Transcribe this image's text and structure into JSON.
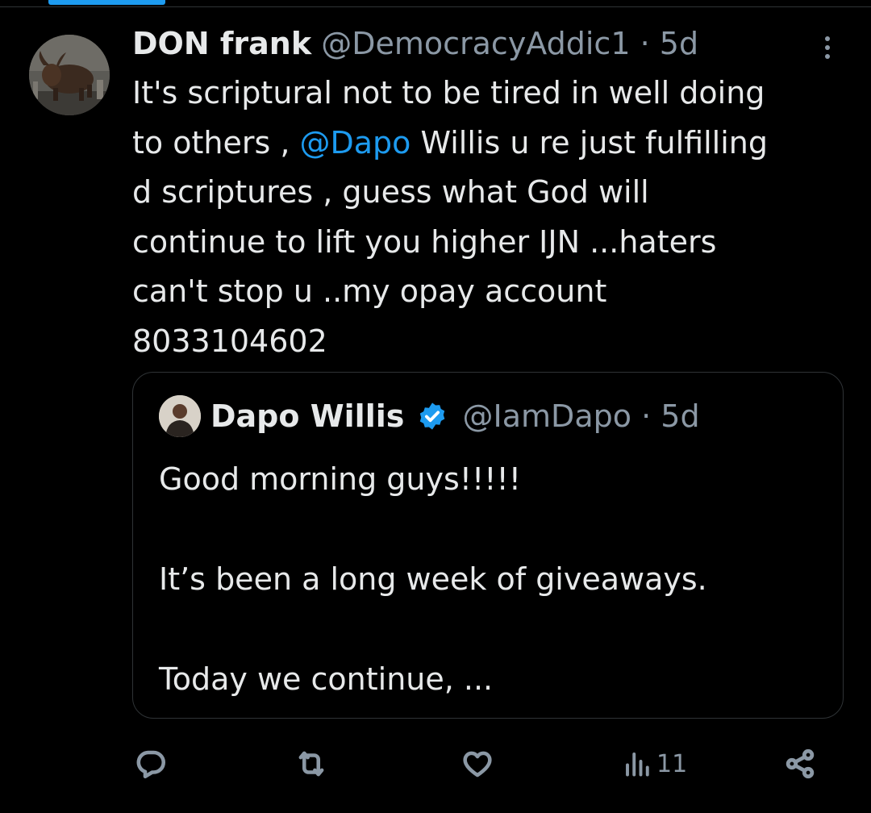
{
  "tweet": {
    "display_name": "DON frank",
    "handle": "@DemocracyAddic1",
    "separator": "·",
    "time": "5d",
    "body": {
      "line1": "It's scriptural not to be tired in well doing",
      "line2_pre": "to others , ",
      "line2_mention": "@Dapo",
      "line2_post": " Willis u re just fulfilling",
      "line3": "d scriptures , guess what God will",
      "line4": "continue to lift you higher IJN ...haters",
      "line5": "can't stop u ..my opay account",
      "line6": "8033104602"
    }
  },
  "quoted": {
    "display_name": "Dapo Willis",
    "handle": "@IamDapo",
    "separator": "·",
    "time": "5d",
    "lines": [
      "Good morning guys!!!!!",
      "",
      "It’s been a long week of giveaways.",
      "",
      "Today we continue, ..."
    ]
  },
  "actions": {
    "reply_icon": "reply-icon",
    "retweet_icon": "retweet-icon",
    "like_icon": "like-icon",
    "views_icon": "views-icon",
    "views_count": "11",
    "share_icon": "share-icon"
  },
  "colors": {
    "background": "#000000",
    "text": "#e7e9ea",
    "secondary": "#8b98a5",
    "accent": "#1d9bf0",
    "border": "#2f3336"
  }
}
